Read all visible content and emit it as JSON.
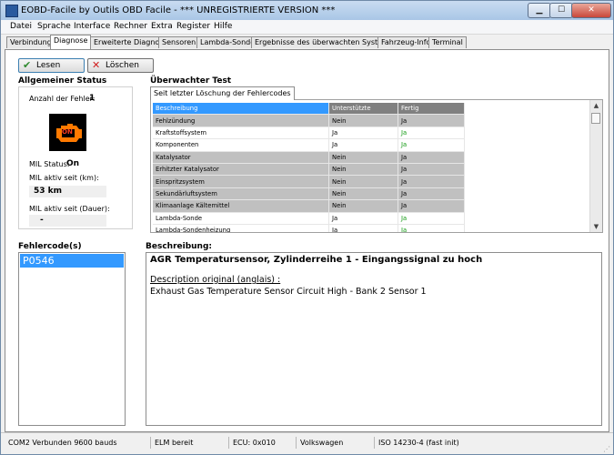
{
  "window": {
    "title": "EOBD-Facile by Outils OBD Facile - *** UNREGISTRIERTE VERSION ***"
  },
  "menu": [
    "Datei",
    "Sprache",
    "Interface",
    "Rechner",
    "Extra",
    "Register",
    "Hilfe"
  ],
  "tabs": [
    "Verbindung",
    "Diagnose",
    "Erweiterte Diagnose",
    "Sensoren",
    "Lambda-Sonde",
    "Ergebnisse des überwachten Systems",
    "Fahrzeug-Info",
    "Terminal"
  ],
  "toolbar": {
    "read_label": "Lesen",
    "delete_label": "Löschen"
  },
  "status": {
    "heading": "Allgemeiner Status",
    "fault_count_label": "Anzahl der Fehler:",
    "fault_count": "1",
    "mil_status_label": "MIL Status:",
    "mil_status": "On",
    "mil_km_label": "MIL aktiv seit (km):",
    "mil_km": "53 km",
    "mil_duration_label": "MIL aktiv seit (Dauer):",
    "mil_duration": "-",
    "engine_icon_text": "ON"
  },
  "monitored": {
    "heading": "Überwachter Test",
    "subtab": "Seit letzter Löschung der Fehlercodes",
    "columns": [
      "Beschreibung",
      "Unterstützte",
      "Fertig"
    ],
    "rows": [
      [
        "Fehlzündung",
        "Nein",
        "Ja"
      ],
      [
        "Kraftstoffsystem",
        "Ja",
        "Ja"
      ],
      [
        "Komponenten",
        "Ja",
        "Ja"
      ],
      [
        "Katalysator",
        "Nein",
        "Ja"
      ],
      [
        "Erhitzter Katalysator",
        "Nein",
        "Ja"
      ],
      [
        "Einspritzsystem",
        "Nein",
        "Ja"
      ],
      [
        "Sekundärluftsystem",
        "Nein",
        "Ja"
      ],
      [
        "Klimaanlage Kältemittel",
        "Nein",
        "Ja"
      ],
      [
        "Lambda-Sonde",
        "Ja",
        "Ja"
      ],
      [
        "Lambda-Sondenheizung",
        "Ja",
        "Ja"
      ]
    ]
  },
  "codes": {
    "heading": "Fehlercode(s)",
    "items": [
      "P0546"
    ]
  },
  "description": {
    "heading": "Beschreibung:",
    "title": "AGR Temperatursensor, Zylinderreihe 1 - Eingangssignal zu hoch",
    "original_label": "Description original (anglais) :",
    "original": "Exhaust Gas Temperature Sensor Circuit High - Bank 2 Sensor 1"
  },
  "statusbar": [
    "COM2 Verbunden 9600 bauds",
    "ELM bereit",
    "ECU: 0x010",
    "Volkswagen",
    "ISO 14230-4 (fast init)"
  ]
}
